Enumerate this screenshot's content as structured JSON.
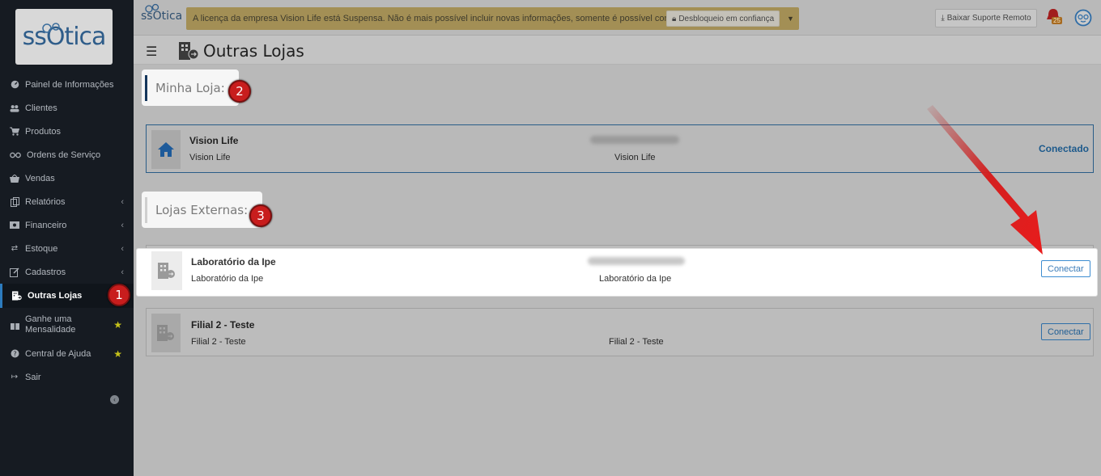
{
  "brand": {
    "logo_text": "ssOtica",
    "top_logo_text": "ssOtica"
  },
  "sidebar": {
    "items": [
      {
        "label": "Painel de Informações",
        "icon": "dashboard-icon"
      },
      {
        "label": "Clientes",
        "icon": "users-icon"
      },
      {
        "label": "Produtos",
        "icon": "cart-icon"
      },
      {
        "label": "Ordens de Serviço",
        "icon": "glasses-icon"
      },
      {
        "label": "Vendas",
        "icon": "basket-icon"
      },
      {
        "label": "Relatórios",
        "icon": "copy-icon"
      },
      {
        "label": "Financeiro",
        "icon": "money-icon"
      },
      {
        "label": "Estoque",
        "icon": "exchange-icon"
      },
      {
        "label": "Cadastros",
        "icon": "edit-icon"
      },
      {
        "label": "Outras Lojas",
        "icon": "building-arrow-icon"
      },
      {
        "label": "Ganhe uma Mensalidade",
        "icon": "gift-icon"
      },
      {
        "label": "Central de Ajuda",
        "icon": "help-icon"
      },
      {
        "label": "Sair",
        "icon": "sign-out-icon"
      }
    ]
  },
  "annotations": {
    "one": "1",
    "two": "2",
    "three": "3"
  },
  "topbar": {
    "alert_text": "A licença da empresa Vision Life está Suspensa. Não é mais possível incluir novas informações, somente é possível consulta...",
    "unlock_label": "Desbloqueio em confiança",
    "support_label": "Baixar Suporte Remoto",
    "notifications_count": "25"
  },
  "page": {
    "title": "Outras Lojas",
    "my_store_label": "Minha Loja:",
    "external_label": "Lojas Externas:"
  },
  "my_store": {
    "name": "Vision Life",
    "subname": "Vision Life",
    "center_name": "Vision Life",
    "status": "Conectado"
  },
  "external_stores": [
    {
      "name": "Laboratório da Ipe",
      "subname": "Laboratório da Ipe",
      "center_name": "Laboratório da Ipe",
      "action": "Conectar"
    },
    {
      "name": "Filial 2 - Teste",
      "subname": "Filial 2 - Teste",
      "center_name": "Filial 2 - Teste",
      "action": "Conectar"
    }
  ],
  "colors": {
    "accent": "#2c7bbd",
    "sidebar_bg": "#161b22",
    "alert_bg": "#a38f55",
    "marker_red": "#c81d1d"
  }
}
